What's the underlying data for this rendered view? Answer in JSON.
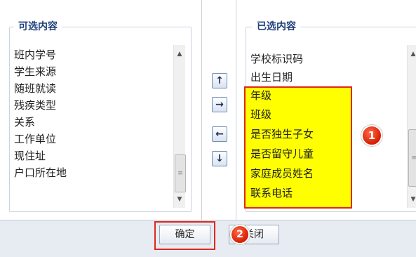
{
  "available": {
    "title": "可选内容",
    "items": [
      "班内学号",
      "学生来源",
      "随班就读",
      "残疾类型",
      "关系",
      "工作单位",
      "现住址",
      "户口所在地"
    ]
  },
  "selected": {
    "title": "已选内容",
    "items": [
      "学校标识码",
      "出生日期",
      "年级",
      "班级",
      "是否独生子女",
      "是否留守儿童",
      "家庭成员姓名",
      "联系电话"
    ],
    "highlighted_items": [
      "年级",
      "班级",
      "是否独生子女",
      "是否留守儿童",
      "家庭成员姓名",
      "联系电话"
    ]
  },
  "move_buttons": {
    "up_icon": "↑",
    "right_icon": "→",
    "left_icon": "←",
    "down_icon": "↓"
  },
  "scrollbar": {
    "up_glyph": "▲",
    "down_glyph": "▼",
    "grip_glyph": "≡"
  },
  "badges": {
    "one": "1",
    "two": "2"
  },
  "footer": {
    "confirm_label": "确定",
    "close_label": "关闭"
  },
  "colors": {
    "highlight_fill": "#ffff00",
    "annotation_red": "#e0281b",
    "legend_text": "#1f3f7a"
  }
}
